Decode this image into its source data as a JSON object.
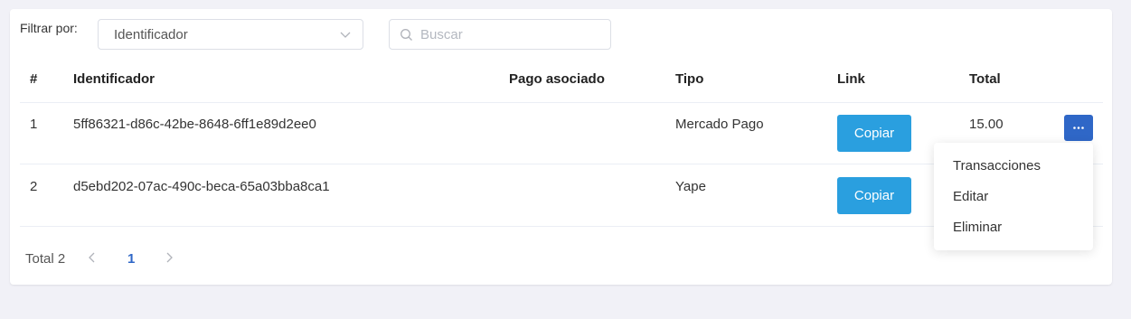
{
  "filter": {
    "label": "Filtrar por:",
    "selected": "Identificador",
    "search_placeholder": "Buscar"
  },
  "table": {
    "columns": [
      "#",
      "Identificador",
      "Pago asociado",
      "Tipo",
      "Link",
      "Total"
    ],
    "rows": [
      {
        "num": "1",
        "identificador": "5ff86321-d86c-42be-8648-6ff1e89d2ee0",
        "pago_asociado": "",
        "tipo": "Mercado Pago",
        "link_label": "Copiar",
        "total": "15.00"
      },
      {
        "num": "2",
        "identificador": "d5ebd202-07ac-490c-beca-65a03bba8ca1",
        "pago_asociado": "",
        "tipo": "Yape",
        "link_label": "Copiar",
        "total": ""
      }
    ]
  },
  "actions_menu": {
    "items": [
      "Transacciones",
      "Editar",
      "Eliminar"
    ]
  },
  "pagination": {
    "total_label": "Total 2",
    "current_page": "1"
  },
  "colors": {
    "primary_button": "#2a9fdf",
    "actions_button": "#2f67c7",
    "page_background": "#f1f1f7"
  },
  "icons": {
    "select_arrow": "chevron-down-icon",
    "search": "search-icon",
    "more": "more-horizontal-icon",
    "prev": "chevron-left-icon",
    "next": "chevron-right-icon"
  }
}
